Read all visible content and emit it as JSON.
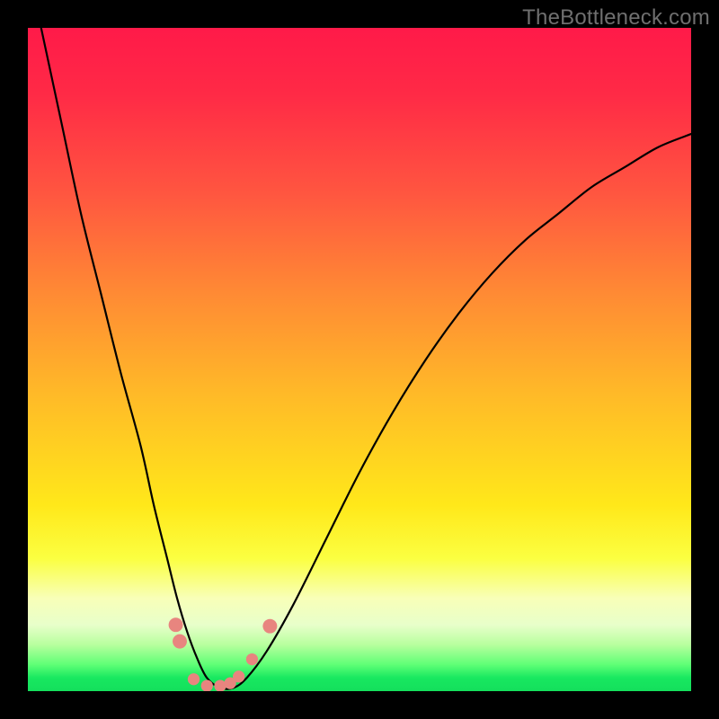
{
  "watermark": "TheBottleneck.com",
  "chart_data": {
    "type": "line",
    "title": "",
    "xlabel": "",
    "ylabel": "",
    "xlim": [
      0,
      100
    ],
    "ylim": [
      0,
      100
    ],
    "grid": false,
    "series": [
      {
        "name": "bottleneck-curve",
        "x": [
          2,
          5,
          8,
          11,
          14,
          17,
          19,
          21,
          22.5,
          24,
          25.5,
          27,
          29,
          31,
          33,
          36,
          40,
          45,
          50,
          55,
          60,
          65,
          70,
          75,
          80,
          85,
          90,
          95,
          100
        ],
        "values": [
          100,
          86,
          72,
          60,
          48,
          37,
          28,
          20,
          14,
          9,
          5,
          2,
          0.5,
          0.5,
          2,
          6,
          13,
          23,
          33,
          42,
          50,
          57,
          63,
          68,
          72,
          76,
          79,
          82,
          84
        ]
      }
    ],
    "markers": {
      "name": "highlight-points",
      "color": "#e8857f",
      "points": [
        {
          "x": 22.3,
          "y": 10.0,
          "r": 1.2
        },
        {
          "x": 22.9,
          "y": 7.5,
          "r": 1.2
        },
        {
          "x": 25.0,
          "y": 1.8,
          "r": 1.0
        },
        {
          "x": 27.0,
          "y": 0.8,
          "r": 1.0
        },
        {
          "x": 29.0,
          "y": 0.8,
          "r": 1.0
        },
        {
          "x": 30.5,
          "y": 1.2,
          "r": 1.0
        },
        {
          "x": 31.8,
          "y": 2.2,
          "r": 1.0
        },
        {
          "x": 33.8,
          "y": 4.8,
          "r": 1.0
        },
        {
          "x": 36.5,
          "y": 9.8,
          "r": 1.2
        }
      ]
    },
    "colors": {
      "curve": "#000000",
      "background_top": "#ff1a49",
      "background_bottom": "#14df5c"
    }
  }
}
